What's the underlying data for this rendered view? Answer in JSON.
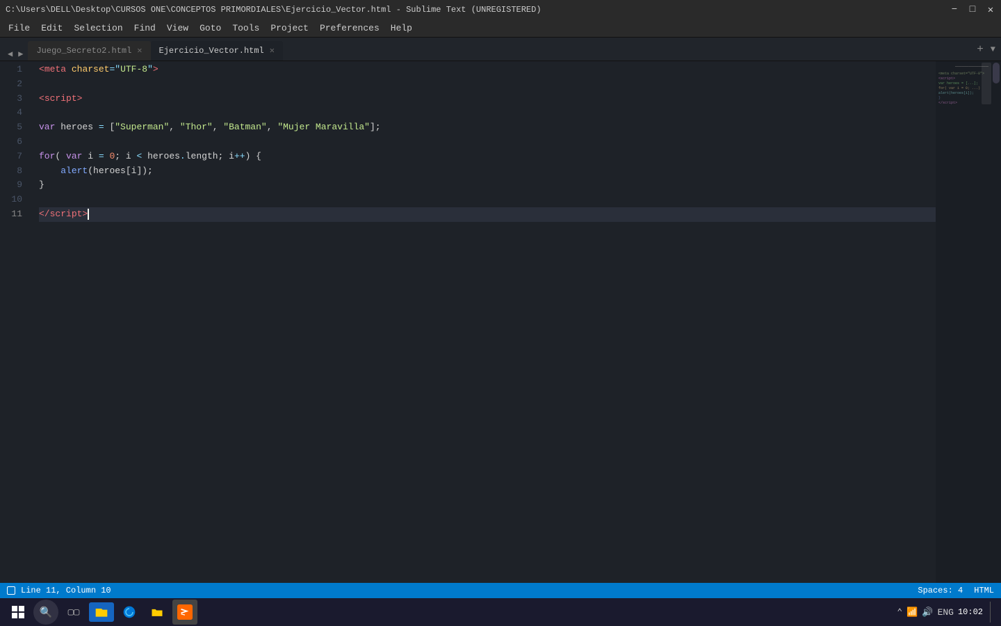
{
  "titlebar": {
    "text": "C:\\Users\\DELL\\Desktop\\CURSOS ONE\\CONCEPTOS PRIMORDIALES\\Ejercicio_Vector.html - Sublime Text (UNREGISTERED)"
  },
  "menu": {
    "items": [
      "File",
      "Edit",
      "Selection",
      "Find",
      "View",
      "Goto",
      "Tools",
      "Project",
      "Preferences",
      "Help"
    ]
  },
  "tabs": [
    {
      "label": "Juego_Secreto2.html",
      "active": false
    },
    {
      "label": "Ejercicio_Vector.html",
      "active": true
    }
  ],
  "statusbar": {
    "line_col": "Line 11, Column 10",
    "spaces": "Spaces: 4",
    "syntax": "HTML"
  },
  "taskbar": {
    "time": "10:02",
    "language": "ENG"
  }
}
